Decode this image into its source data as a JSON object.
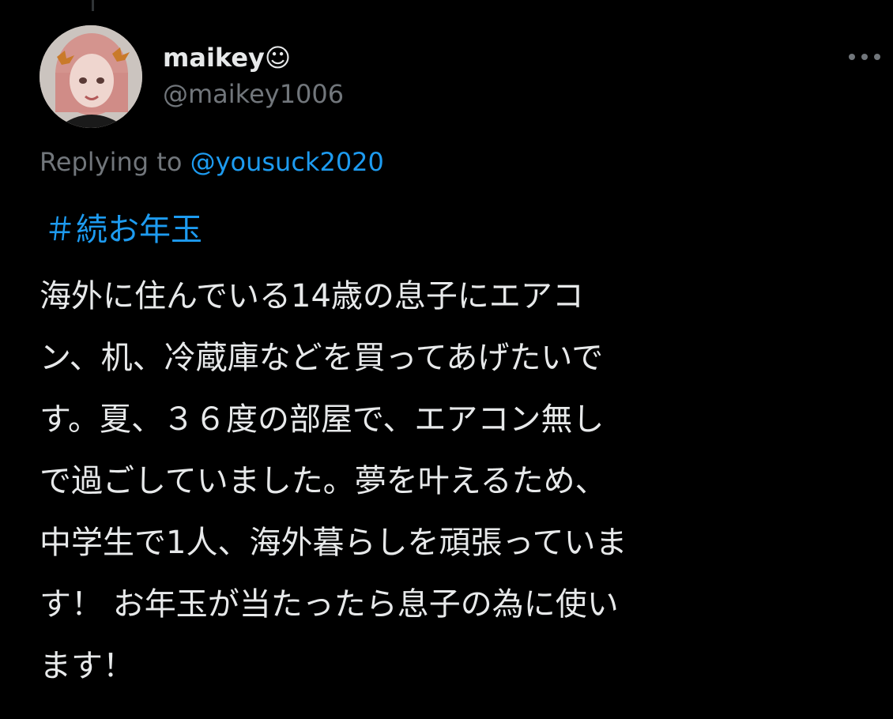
{
  "tweet": {
    "author": {
      "display_name": "maikey☺",
      "handle": "@maikey1006",
      "avatar_icon": "profile-photo"
    },
    "more_icon": "ellipsis-horizontal-icon",
    "reply_prefix": "Replying to",
    "reply_to": "@yousuck2020",
    "hashtag": "＃続お年玉",
    "body_lines": [
      "海外に住んでいる14歳の息子にエアコ",
      "ン、机、冷蔵庫などを買ってあげたいで",
      "す。夏、３６度の部屋で、エアコン無し",
      "で過ごしていました。夢を叶えるため、",
      "中学生で1人、海外暮らしを頑張っていま",
      "す！ お年玉が当たったら息子の為に使い",
      "ます！"
    ]
  },
  "colors": {
    "background": "#000000",
    "primary_text": "#e7e9ea",
    "secondary_text": "#71767b",
    "link": "#1d9bf0"
  }
}
